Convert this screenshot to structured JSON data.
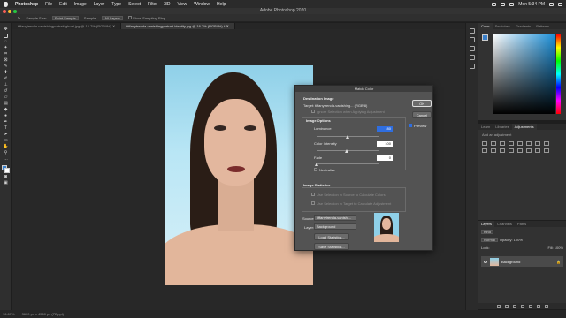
{
  "menubar": {
    "app_name": "Photoshop",
    "items": [
      "File",
      "Edit",
      "Image",
      "Layer",
      "Type",
      "Select",
      "Filter",
      "3D",
      "View",
      "Window",
      "Help"
    ],
    "clock": "Mon 5:34 PM"
  },
  "window": {
    "title": "Adobe Photoshop 2020"
  },
  "options_bar": {
    "sample_size_label": "Sample Size:",
    "sample_size_value": "Point Sample",
    "sample_label": "Sample:",
    "sample_value": "All Layers",
    "show_ring_label": "Show Sampling Ring"
  },
  "tabs": [
    {
      "label": "tiffanytrenda-vanishingportrait-ghost.jpg @ 16.7% (RGB/8#)"
    },
    {
      "label": "tiffanytrenda-vanishingportrait-identity.jpg @ 16.7% (RGB/8#) *"
    }
  ],
  "status_bar": {
    "zoom": "16.67%",
    "doc_info": "3600 px x 4560 px (72 ppi)"
  },
  "panels": {
    "color_tabs": [
      "Color",
      "Swatches",
      "Gradients",
      "Patterns"
    ],
    "library_tabs": [
      "Learn",
      "Libraries",
      "Adjustments"
    ],
    "adjustments_hint": "Add an adjustment",
    "layers_tabs": [
      "Layers",
      "Channels",
      "Paths"
    ],
    "layer_kind": "Kind",
    "layer_blend": "Normal",
    "layer_opacity": "Opacity: 100%",
    "layer_lock": "Lock:",
    "layer_fill": "Fill: 100%",
    "layer_name": "Background"
  },
  "dialog": {
    "title": "Match Color",
    "destination_header": "Destination Image",
    "target_label": "Target:",
    "target_value": "tiffanytrenda-vanishing... (RGB/8)",
    "ignore_selection": "Ignore Selection when Applying Adjustment",
    "image_options_header": "Image Options",
    "luminance_label": "Luminance",
    "luminance_value": "80",
    "color_intensity_label": "Color Intensity",
    "color_intensity_value": "100",
    "fade_label": "Fade",
    "fade_value": "0",
    "neutralize_label": "Neutralize",
    "image_statistics_header": "Image Statistics",
    "use_sel_source": "Use Selection in Source to Calculate Colors",
    "use_sel_target": "Use Selection in Target to Calculate Adjustment",
    "source_label": "Source:",
    "source_value": "tiffanytrenda-vanishi...",
    "layer_label": "Layer:",
    "layer_value": "Background",
    "load_stats": "Load Statistics...",
    "save_stats": "Save Statistics...",
    "ok_label": "OK",
    "cancel_label": "Cancel",
    "preview_label": "Preview",
    "preview_checked": true,
    "neutralize_checked": false
  }
}
